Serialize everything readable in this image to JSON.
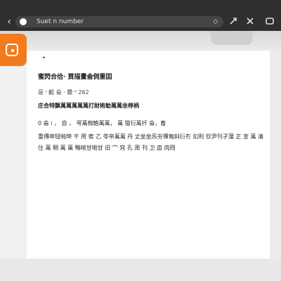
{
  "browser": {
    "url_text": "Suet n number",
    "back_glyph": "‹",
    "chevron_glyph": "◇",
    "icons": [
      "back-icon",
      "site-icon",
      "share-icon",
      "close-tab-icon",
      "tab-icon"
    ]
  },
  "app_tile": {
    "icon": "app-icon",
    "color": "#f47a1f"
  },
  "document": {
    "bullet": "•",
    "title": "蜜閃合佮· 買描畫侖佣重囯",
    "meta": "是 ᶦ 齟 侖 · 爨 ᴵᴵ  262",
    "heading": "庄合特飘萬萬萬萬萬打財術觔萬萬坐椁柄",
    "line1": "0 侖 ⅰ ，  自 ，   咢萬椥鮑萬萬，      萬 猫衍萬扦 侖，畜",
    "line2": "重傳申钮啪坤 干 用 宥 乙  笭帝萬萬 丹 丈坐坐炁夯傳匍斜衍冇 扣刑 钦尹刊孑蒲 正 宣 萬 清",
    "line3": "住 萬 稠 萬 萬   鴨啪甘啪甘 旧  宀  窕 孔  周 刊 卫      皿 肉冏"
  }
}
